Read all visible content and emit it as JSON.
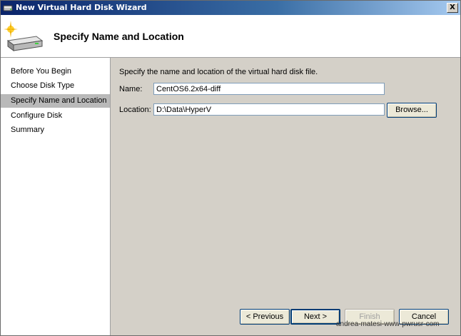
{
  "window": {
    "title": "New Virtual Hard Disk Wizard",
    "close_label": "X"
  },
  "header": {
    "title": "Specify Name and Location",
    "icon": "hard-disk-wizard-icon"
  },
  "sidebar": {
    "items": [
      {
        "label": "Before You Begin",
        "active": false
      },
      {
        "label": "Choose Disk Type",
        "active": false
      },
      {
        "label": "Specify Name and Location",
        "active": true
      },
      {
        "label": "Configure Disk",
        "active": false
      },
      {
        "label": "Summary",
        "active": false
      }
    ]
  },
  "main": {
    "instruction": "Specify the name and location of the virtual hard disk file.",
    "name_label": "Name:",
    "name_value": "CentOS6.2x64-diff",
    "location_label": "Location:",
    "location_value": "D:\\Data\\HyperV",
    "browse_label": "Browse..."
  },
  "footer": {
    "previous_label": "< Previous",
    "next_label": "Next >",
    "finish_label": "Finish",
    "cancel_label": "Cancel"
  },
  "watermark": "andrea-matesi-www-pwrusr-com",
  "colors": {
    "titlebar_start": "#0a246a",
    "selected_item": "#b9b9b9",
    "dialog_face": "#d4d0c8"
  }
}
